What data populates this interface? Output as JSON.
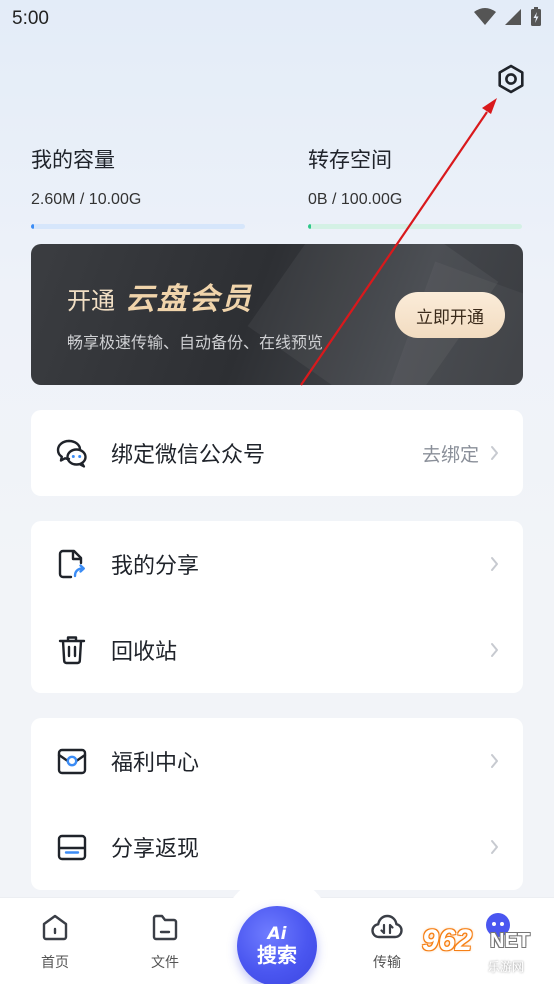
{
  "status_bar": {
    "time": "5:00"
  },
  "quota": {
    "my_capacity": {
      "title": "我的容量",
      "value": "2.60M / 10.00G",
      "progress": 0.0003,
      "color": "#3b8cf5"
    },
    "transfer_space": {
      "title": "转存空间",
      "value": "0B / 100.00G",
      "progress": 0.0,
      "color": "#2ec78a"
    }
  },
  "vip_banner": {
    "open_text": "开通",
    "brand_text": "云盘会员",
    "subtitle": "畅享极速传输、自动备份、在线预览",
    "button_label": "立即开通"
  },
  "wechat_card": {
    "label": "绑定微信公众号",
    "action": "去绑定"
  },
  "share_card": {
    "items": [
      {
        "label": "我的分享"
      },
      {
        "label": "回收站"
      }
    ]
  },
  "welfare_card": {
    "items": [
      {
        "label": "福利中心"
      },
      {
        "label": "分享返现"
      }
    ]
  },
  "tabbar": {
    "home": "首页",
    "files": "文件",
    "search_ai": "Ai",
    "search": "搜索",
    "transfer": "传输"
  },
  "watermark": {
    "number": "962",
    "net": "NET",
    "site": "乐游网"
  },
  "colors": {
    "accent": "#4a56f0",
    "annotation_arrow": "#d9191c"
  }
}
